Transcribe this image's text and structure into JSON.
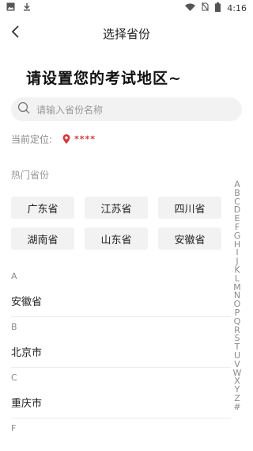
{
  "status_bar": {
    "time": "4:16",
    "icons": [
      "image-icon",
      "download-icon",
      "wifi-icon",
      "no-sim-icon",
      "battery-icon"
    ]
  },
  "header": {
    "title": "选择省份",
    "back_icon": "chevron-left-icon"
  },
  "heading": "请设置您的考试地区~",
  "search": {
    "placeholder": "请输入省份名称",
    "icon": "search-icon"
  },
  "location": {
    "label": "当前定位:",
    "value": "****",
    "icon": "location-pin-icon",
    "color": "#d23b3b"
  },
  "hot": {
    "title": "热门省份",
    "items": [
      "广东省",
      "江苏省",
      "四川省",
      "湖南省",
      "山东省",
      "安徽省"
    ]
  },
  "sections": [
    {
      "letter": "A",
      "items": [
        "安徽省"
      ]
    },
    {
      "letter": "B",
      "items": [
        "北京市"
      ]
    },
    {
      "letter": "C",
      "items": [
        "重庆市"
      ]
    },
    {
      "letter": "F",
      "items": []
    }
  ],
  "index_letters": [
    "A",
    "B",
    "C",
    "D",
    "E",
    "F",
    "G",
    "H",
    "I",
    "J",
    "K",
    "L",
    "M",
    "N",
    "O",
    "P",
    "Q",
    "R",
    "S",
    "T",
    "U",
    "V",
    "W",
    "X",
    "Y",
    "Z",
    "#"
  ]
}
